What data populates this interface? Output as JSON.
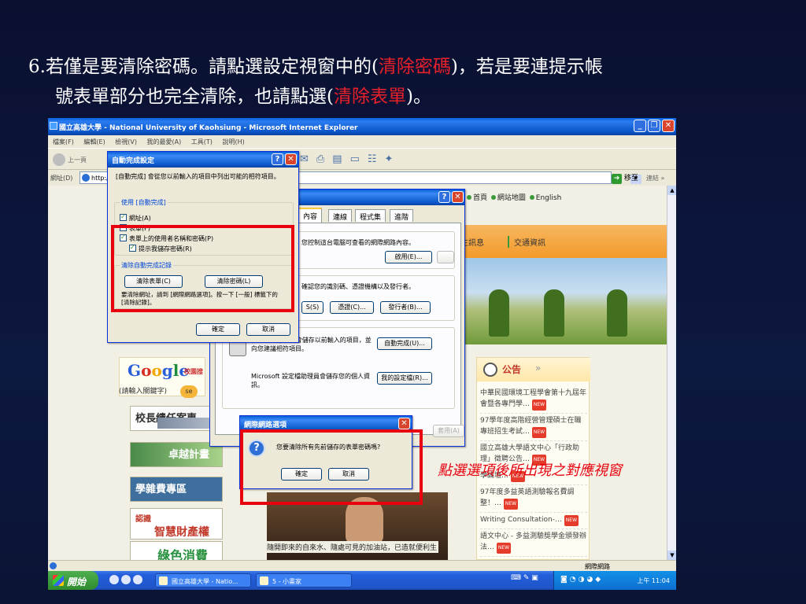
{
  "slide": {
    "line1_prefix": "6.若僅是要清除密碼。請點選設定視窗中的(",
    "line1_highlight": "清除密碼",
    "line1_suffix": ")，若是要連提示帳",
    "line2_prefix": "號表單部分也完全清除，也請點選(",
    "line2_highlight": "清除表單",
    "line2_suffix": ")。",
    "caption": "點選選項後所出現之對應視窗"
  },
  "browser": {
    "title": "國立高雄大學 - National University of Kaohsiung - Microsoft Internet Explorer",
    "menu": [
      "檔案(F)",
      "編輯(E)",
      "檢視(V)",
      "我的最愛(A)",
      "工具(T)",
      "說明(H)"
    ],
    "back_label": "上一頁",
    "address_label": "網址(D)",
    "address_value": "http:/",
    "go_label": "移至",
    "links_label": "連結 »",
    "status_zone": "網際網路"
  },
  "website": {
    "topnav": [
      "首頁",
      "網站地圖",
      "English"
    ],
    "orange_links": [
      "生訊息",
      "交通資訊"
    ],
    "google_sub": "校園搜",
    "search_hint": "(請輸入關鍵字)",
    "search_btn": "se",
    "tiles": [
      "校長績任案專",
      "卓越計畫",
      "學雜費專區",
      "智慧財產權",
      "綠色消費"
    ],
    "tile4_small": "認識",
    "notice_title": "公告",
    "notices": [
      "中華民國環境工程學會第十九屆年會暨各專門學…",
      "97學年度高階經營管理碩士在職專班招生考試…",
      "國立高雄大學語文中心「行政助理」徵聘公告…",
      "學論壇…",
      "97年度多益英語測驗報名費調整！…",
      "Writing Consultation-…",
      "語文中心 - 多益測驗獎學金頒發辦法…"
    ],
    "news_caption": "隨開即來的自來水、隨處可見的加油站，已造就便利生"
  },
  "options_dialog": {
    "tabs": [
      "內容",
      "連線",
      "程式集",
      "進階"
    ],
    "content_text": "您控制這台電腦可查看的網際網路內容。",
    "enable_btn": "啟用(E)...",
    "settings_btn": "設定(T)...",
    "cert_text": "確認您的識別碼、憑證機構以及發行者。",
    "ssl_btn": "S(S)",
    "cert_btn": "憑證(C)...",
    "publisher_btn": "發行者(B)...",
    "autocomplete_text": "[自動完成] 功能會儲存以前輸入的項目，並向您建議相符項目。",
    "autocomplete_btn": "自動完成(U)...",
    "profile_text": "Microsoft 設定檔助理員會儲存您的個人資訊。",
    "profile_btn": "我的設定檔(R)...",
    "apply_btn": "套用(A)"
  },
  "autocomplete_dialog": {
    "title": "自動完成設定",
    "desc": "[自動完成] 會從您以前輸入的項目中列出可能的相符項目。",
    "group_use": "使用 [自動完成]",
    "opt_address": "網址(A)",
    "opt_forms": "表單(F)",
    "opt_userpass": "表單上的使用者名稱和密碼(P)",
    "opt_prompt": "提示我儲存密碼(R)",
    "group_clear": "清除自動完成記錄",
    "clear_forms_btn": "清除表單(C)",
    "clear_pass_btn": "清除密碼(L)",
    "hint": "要清除網址，請到 [網際網路選項]。按一下 [一般] 標籤下的 [清除記錄]。",
    "ok_btn": "確定",
    "cancel_btn": "取消"
  },
  "confirm_dialog": {
    "title": "網際網路選項",
    "message": "您要清除所有先前儲存的表單密碼嗎?",
    "ok_btn": "確定",
    "cancel_btn": "取消"
  },
  "taskbar": {
    "start": "開始",
    "task1": "國立高雄大學 - Natio...",
    "task2": "5 - 小畫家",
    "clock": "上午 11:04"
  },
  "colors": {
    "highlight_red": "#e8202a",
    "xp_blue": "#0a5fd8"
  }
}
